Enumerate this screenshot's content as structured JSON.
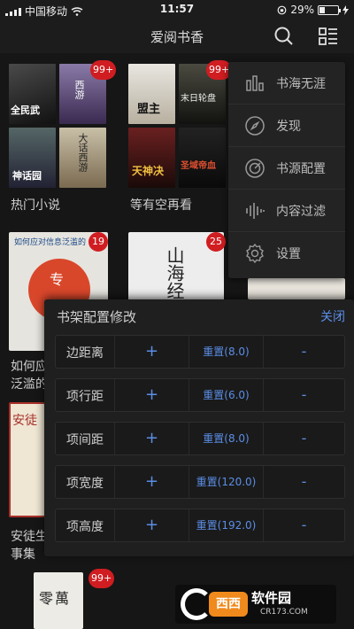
{
  "status_bar": {
    "carrier": "中国移动",
    "time": "11:57",
    "battery": "29%",
    "battery_level": 0.29
  },
  "nav": {
    "title": "爱阅书香"
  },
  "shelf": {
    "books": [
      {
        "title": "热门小说",
        "badge": "99+"
      },
      {
        "title": "等有空再看",
        "badge": "99+"
      },
      {
        "title": "如何应对信息泛滥的",
        "title_visible": "如何应\n泛滥的",
        "badge": "19",
        "cover_text_1": "如何应对信息泛滥的",
        "cover_text_2": "专"
      },
      {
        "title": "",
        "badge": "25",
        "cover_text": "山海经"
      },
      {
        "title": "安徒生童话",
        "title_visible": "安徒生\n事集",
        "badge": "",
        "cover_text": "安徒"
      },
      {
        "title": "",
        "badge": "99+",
        "cover_text": "零萬"
      }
    ],
    "mini_covers_1": [
      "全民武",
      "西游",
      "神话园",
      "大话西游"
    ],
    "mini_covers_2": [
      "盟主",
      "末日轮盘",
      "天神决",
      "圣域帝血"
    ]
  },
  "dropdown": {
    "items": [
      {
        "label": "书海无涯",
        "icon": "bar-chart-icon"
      },
      {
        "label": "发现",
        "icon": "compass-icon"
      },
      {
        "label": "书源配置",
        "icon": "target-icon"
      },
      {
        "label": "内容过滤",
        "icon": "waveform-icon"
      },
      {
        "label": "设置",
        "icon": "gear-icon"
      }
    ]
  },
  "config_panel": {
    "title": "书架配置修改",
    "close": "关闭",
    "rows": [
      {
        "label": "边距离",
        "plus": "+",
        "reset": "重置(8.0)",
        "minus": "-"
      },
      {
        "label": "项行距",
        "plus": "+",
        "reset": "重置(6.0)",
        "minus": "-"
      },
      {
        "label": "项间距",
        "plus": "+",
        "reset": "重置(8.0)",
        "minus": "-"
      },
      {
        "label": "项宽度",
        "plus": "+",
        "reset": "重置(120.0)",
        "minus": "-"
      },
      {
        "label": "项高度",
        "plus": "+",
        "reset": "重置(192.0)",
        "minus": "-"
      }
    ]
  },
  "watermark": {
    "brand": "西西",
    "text": "软件园",
    "sub": "CR173.COM"
  },
  "colors": {
    "accent": "#5b8ee6",
    "badge": "#d01d21",
    "background": "#161616"
  }
}
